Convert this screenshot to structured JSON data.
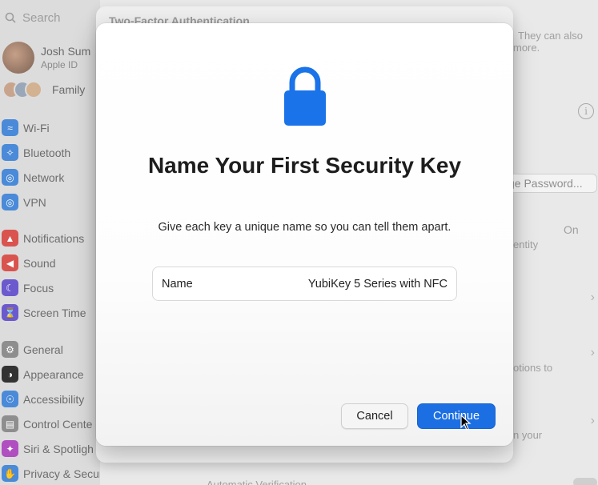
{
  "search": {
    "placeholder": "Search"
  },
  "profile": {
    "name": "Josh Sum",
    "subtitle": "Apple ID"
  },
  "family": {
    "label": "Family"
  },
  "sidebar": {
    "items": [
      {
        "label": "Wi-Fi",
        "icon": "wifi-icon",
        "color": "#4a8ad8"
      },
      {
        "label": "Bluetooth",
        "icon": "bluetooth-icon",
        "color": "#4a8ad8"
      },
      {
        "label": "Network",
        "icon": "globe-icon",
        "color": "#4a8ad8"
      },
      {
        "label": "VPN",
        "icon": "vpn-globe-icon",
        "color": "#4a8ad8"
      },
      {
        "label": "Notifications",
        "icon": "bell-icon",
        "color": "#d9534f"
      },
      {
        "label": "Sound",
        "icon": "speaker-icon",
        "color": "#d9534f"
      },
      {
        "label": "Focus",
        "icon": "moon-icon",
        "color": "#6a5acd"
      },
      {
        "label": "Screen Time",
        "icon": "hourglass-icon",
        "color": "#6a5acd"
      },
      {
        "label": "General",
        "icon": "gear-icon",
        "color": "#8e8e8e"
      },
      {
        "label": "Appearance",
        "icon": "appearance-icon",
        "color": "#333333"
      },
      {
        "label": "Accessibility",
        "icon": "accessibility-icon",
        "color": "#4a8ad8"
      },
      {
        "label": "Control Cente",
        "icon": "control-center-icon",
        "color": "#8e8e8e"
      },
      {
        "label": "Siri & Spotligh",
        "icon": "siri-icon",
        "color": "#b04fc0"
      },
      {
        "label": "Privacy & Security",
        "icon": "hand-icon",
        "color": "#4a8ad8"
      }
    ]
  },
  "background_window": {
    "title": "Two-Factor Authentication",
    "text_1a": "They can also",
    "text_1b": "more.",
    "change_password": "ge Password...",
    "on_label": "On",
    "identity_text": "entity",
    "options_text": "otions to",
    "your_text": "n your",
    "bottom_text": "Automatic Verification"
  },
  "modal": {
    "icon": "lock-icon",
    "title": "Name Your First Security Key",
    "subtitle": "Give each key a unique name so you can tell them apart.",
    "field_label": "Name",
    "field_value": "YubiKey 5 Series with NFC",
    "cancel_label": "Cancel",
    "continue_label": "Continue",
    "accent_color": "#1c6fe3"
  }
}
